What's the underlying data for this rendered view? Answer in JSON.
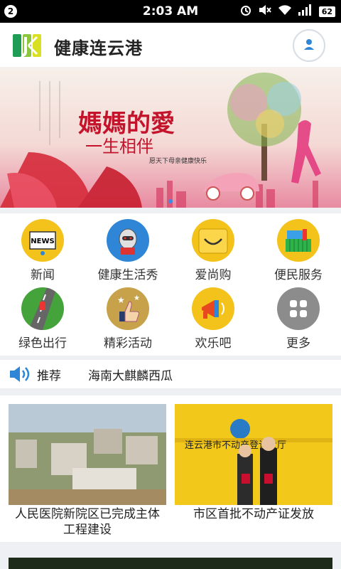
{
  "status": {
    "badge": "2",
    "time": "2:03 AM",
    "battery": "62"
  },
  "header": {
    "title": "健康连云港"
  },
  "banner": {
    "title": "媽媽的愛",
    "subtitle": "一生相伴",
    "caption": "愿天下母亲健康快乐"
  },
  "grid": [
    {
      "label": "新闻"
    },
    {
      "label": "健康生活秀"
    },
    {
      "label": "爱尚购"
    },
    {
      "label": "便民服务"
    },
    {
      "label": "绿色出行"
    },
    {
      "label": "精彩活动"
    },
    {
      "label": "欢乐吧"
    },
    {
      "label": "更多"
    }
  ],
  "recommend": {
    "label": "推荐",
    "item": "海南大麒麟西瓜"
  },
  "news": [
    {
      "caption": "人民医院新院区已完成主体工程建设"
    },
    {
      "caption": "市区首批不动产证发放"
    }
  ],
  "colors": {
    "accent": "#2f86d6",
    "header_bg": "#ffffff"
  }
}
